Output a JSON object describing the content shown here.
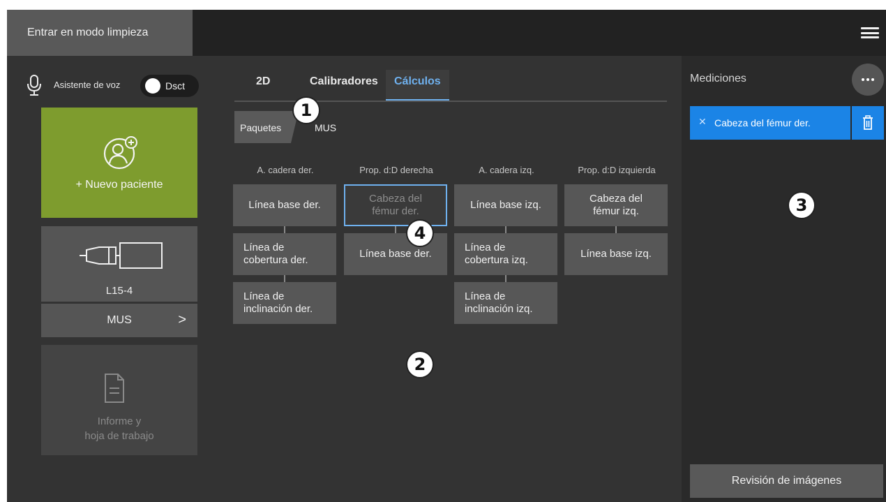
{
  "topbar": {
    "clean_mode_label": "Entrar en modo limpieza",
    "menu_icon": "hamburger-menu-icon"
  },
  "voice": {
    "label": "Asistente de voz",
    "toggle_state": "Dsct",
    "mic_icon": "microphone-icon"
  },
  "new_patient": {
    "label": "+ Nuevo paciente",
    "icon": "add-patient-icon"
  },
  "probe": {
    "label": "L15-4",
    "icon": "linear-probe-icon"
  },
  "preset": {
    "label": "MUS",
    "chevron": ">"
  },
  "report": {
    "label": "Informe y\nhoja de trabajo",
    "icon": "document-icon"
  },
  "tabs": [
    {
      "label": "2D",
      "active": false
    },
    {
      "label": "Calibradores",
      "active": false
    },
    {
      "label": "Cálculos",
      "active": true
    }
  ],
  "breadcrumb": {
    "packages": "Paquetes",
    "current": "MUS"
  },
  "calc_columns": [
    {
      "header": "A. cadera der.",
      "items": [
        "Línea base der.",
        "Línea de\ncobertura der.",
        "Línea de\ninclinación der."
      ]
    },
    {
      "header": "Prop. d:D derecha",
      "items": [
        "Cabeza del\nfémur der.",
        "Línea base der."
      ],
      "selected_index": 0
    },
    {
      "header": "A. cadera izq.",
      "items": [
        "Línea base izq.",
        "Línea de\ncobertura izq.",
        "Línea de\ninclinación izq."
      ]
    },
    {
      "header": "Prop. d:D izquierda",
      "items": [
        "Cabeza del\nfémur izq.",
        "Línea base izq."
      ]
    }
  ],
  "measurements": {
    "title": "Mediciones",
    "items": [
      {
        "label": "Cabeza del fémur der.",
        "marker": "✕"
      }
    ],
    "review_label": "Revisión de imágenes"
  },
  "callouts": [
    "1",
    "2",
    "3",
    "4"
  ],
  "colors": {
    "accent_blue": "#1b84e6",
    "tab_active": "#6fb1ef",
    "patient_green": "#7e9c2e",
    "background": "#333333"
  }
}
